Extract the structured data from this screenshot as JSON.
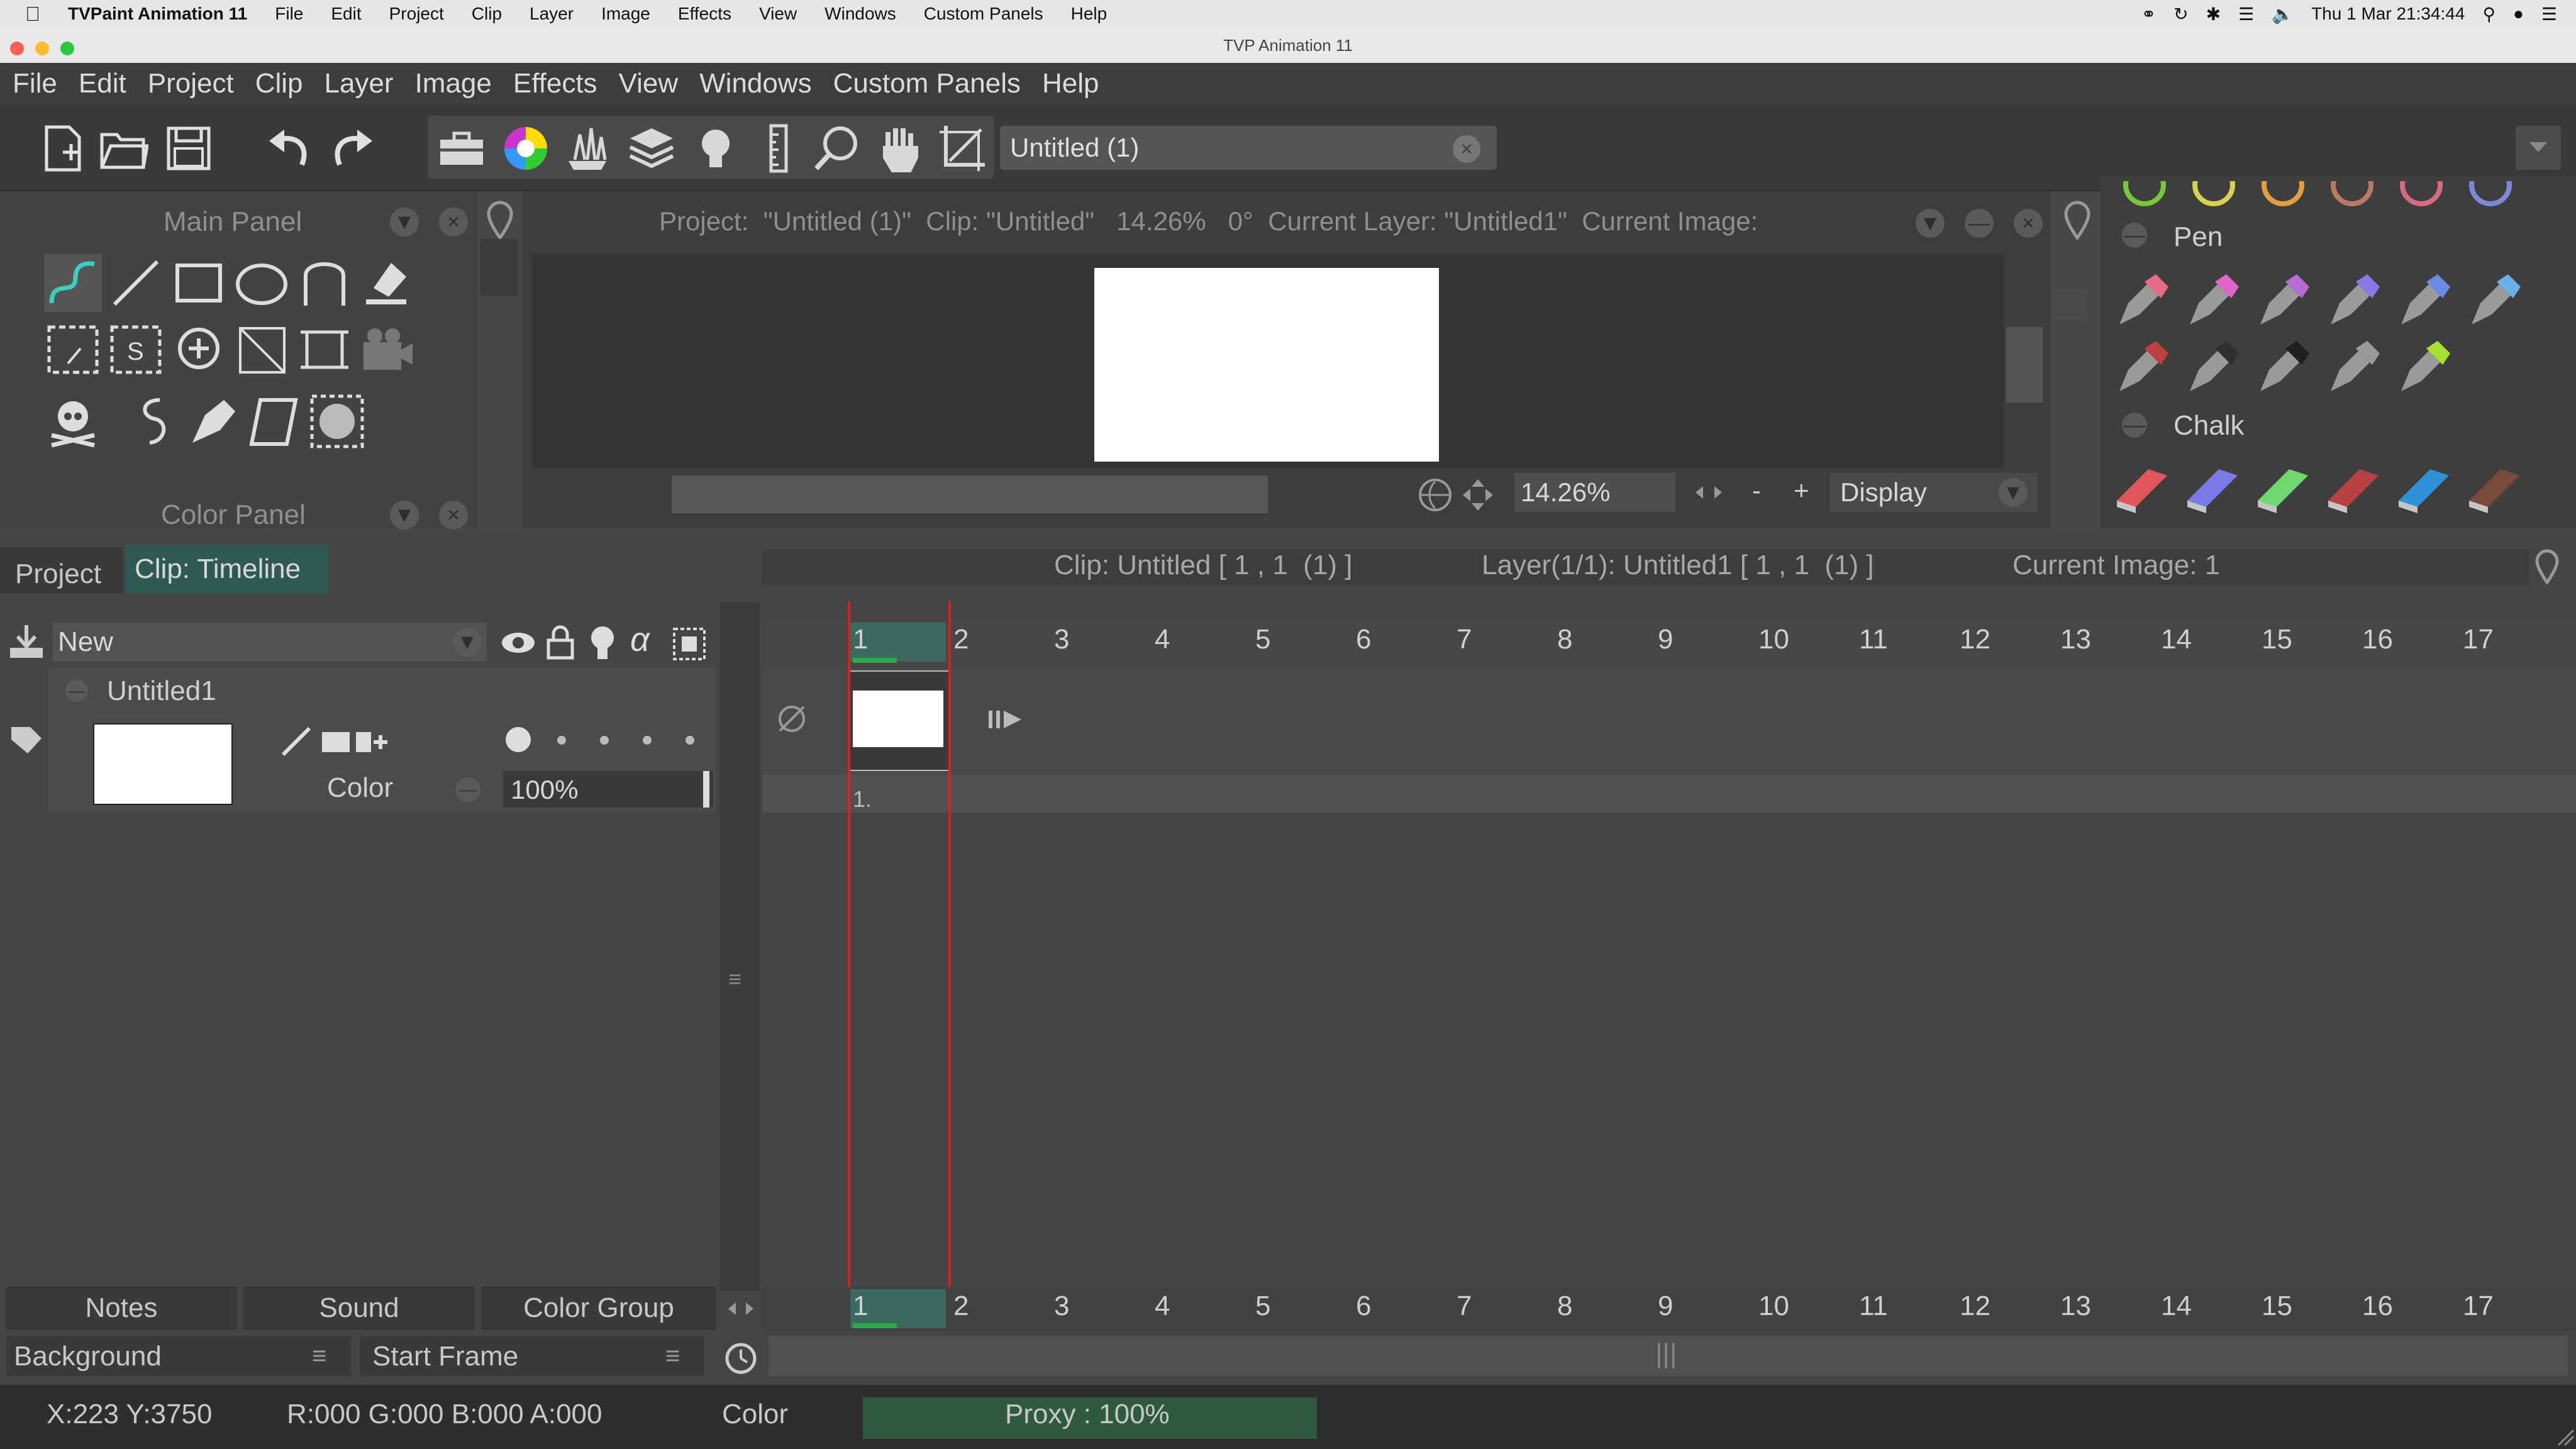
{
  "mac_menubar": {
    "app_name": "TVPaint Animation 11",
    "items": [
      "File",
      "Edit",
      "Project",
      "Clip",
      "Layer",
      "Image",
      "Effects",
      "View",
      "Windows",
      "Custom Panels",
      "Help"
    ],
    "datetime": "Thu 1 Mar  21:34:44"
  },
  "window": {
    "title": "TVP Animation 11"
  },
  "app_menu": {
    "items": [
      "File",
      "Edit",
      "Project",
      "Clip",
      "Layer",
      "Image",
      "Effects",
      "View",
      "Windows",
      "Custom Panels",
      "Help"
    ]
  },
  "toolbar": {
    "document_name": "Untitled (1)",
    "icons": [
      "new-document",
      "open-folder",
      "save",
      "undo",
      "redo",
      "toolbox",
      "color-wheel",
      "fx",
      "layers",
      "lightbulb",
      "ruler",
      "magnifier",
      "hand",
      "crop"
    ]
  },
  "main_panel": {
    "title": "Main Panel",
    "tools_row1": [
      "freehand-curve",
      "line",
      "rectangle",
      "ellipse",
      "spline",
      "eraser-tool"
    ],
    "tools_row2": [
      "rect-selection",
      "shape-selection",
      "zoom-in",
      "transform",
      "warp",
      "camera"
    ],
    "tools_row3": [
      "skull",
      "curly-brush",
      "pen-nib",
      "paper",
      "checker"
    ]
  },
  "color_panel": {
    "title": "Color Panel"
  },
  "viewer": {
    "info": "Project:  \"Untitled (1)\"  Clip: \"Untitled\"   14.26%   0°  Current Layer: \"Untitled1\"  Current Image:",
    "zoom": "14.26%",
    "zoom_minus": "-",
    "zoom_plus": "+",
    "display_label": "Display"
  },
  "brush_panel": {
    "pen_section": "Pen",
    "chalk_section": "Chalk",
    "pen_colors": [
      "#e86a8a",
      "#e066c8",
      "#b86ad6",
      "#8a78e6",
      "#6a8ae6",
      "#6ab0e6"
    ],
    "pen2_colors": [
      "#c04040",
      "#303030",
      "#202020",
      "#9a9a9a",
      "#a8e030"
    ],
    "chalk_colors": [
      "#e0555a",
      "#7a7ae6",
      "#70d870",
      "#b84040",
      "#3090d8",
      "#7a4a3a"
    ]
  },
  "timeline": {
    "tabs": {
      "project": "Project",
      "clip": "Clip: Timeline"
    },
    "info": {
      "clip": "Clip: Untitled [ 1 , 1  (1) ]",
      "layer": "Layer(1/1): Untitled1 [ 1 , 1  (1) ]",
      "image": "Current Image: 1"
    },
    "new_layer_label": "New",
    "layer_name": "Untitled1",
    "layer_color_label": "Color",
    "opacity": "100%",
    "frame_numbers": [
      "1",
      "2",
      "3",
      "4",
      "5",
      "6",
      "7",
      "8",
      "9",
      "10",
      "11",
      "12",
      "13",
      "14",
      "15",
      "16",
      "17"
    ],
    "cell_label": "1.",
    "bottom_tabs": [
      "Notes",
      "Sound",
      "Color Group"
    ],
    "background_label": "Background",
    "start_frame_label": "Start Frame"
  },
  "statusbar": {
    "coords": "X:223  Y:3750",
    "rgba": "R:000 G:000 B:000 A:000",
    "mode": "Color",
    "proxy": "Proxy : 100%"
  }
}
